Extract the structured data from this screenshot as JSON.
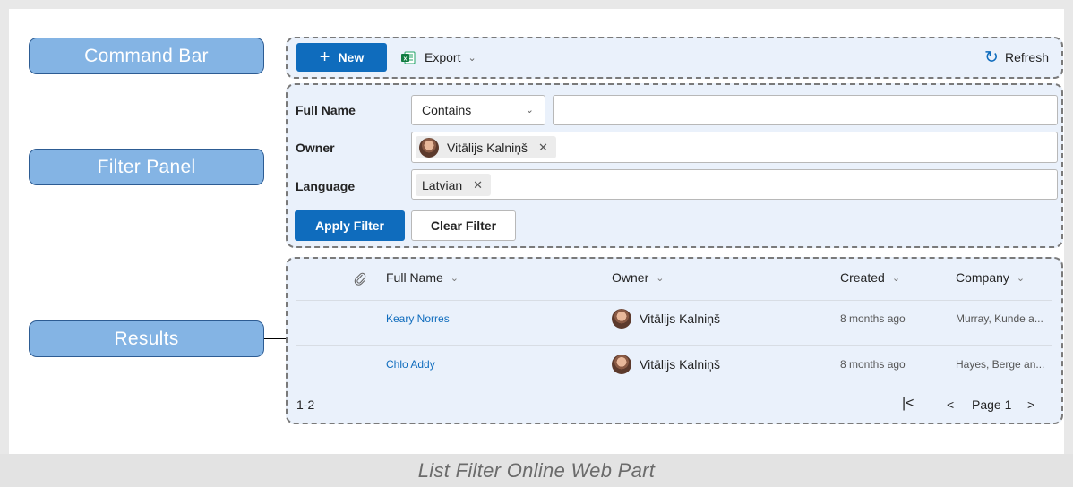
{
  "callouts": {
    "command_bar": "Command Bar",
    "filter_panel": "Filter Panel",
    "results": "Results"
  },
  "command_bar": {
    "new_label": "New",
    "export_label": "Export",
    "refresh_label": "Refresh"
  },
  "filters": {
    "full_name_label": "Full Name",
    "full_name_operator": "Contains",
    "full_name_value": "",
    "owner_label": "Owner",
    "owner_tag": "Vitālijs Kalniņš",
    "language_label": "Language",
    "language_tag": "Latvian",
    "apply_label": "Apply Filter",
    "clear_label": "Clear Filter"
  },
  "results": {
    "columns": {
      "full_name": "Full Name",
      "owner": "Owner",
      "created": "Created",
      "company": "Company"
    },
    "rows": [
      {
        "full_name": "Keary Norres",
        "owner": "Vitālijs Kalniņš",
        "created": "8 months ago",
        "company": "Murray, Kunde a..."
      },
      {
        "full_name": "Chlo Addy",
        "owner": "Vitālijs Kalniņš",
        "created": "8 months ago",
        "company": "Hayes, Berge an..."
      }
    ],
    "range": "1-2",
    "page_label": "Page 1"
  },
  "caption": "List Filter Online Web Part",
  "icons": {
    "attachment": "paperclip-icon",
    "refresh": "refresh-icon",
    "export": "excel-icon",
    "first_page": "first-page-icon",
    "prev_page": "prev-page-icon",
    "next_page": "next-page-icon"
  },
  "colors": {
    "accent": "#0f6cbd",
    "callout_fill": "#84b4e4",
    "region_fill": "#eaf1fb"
  }
}
